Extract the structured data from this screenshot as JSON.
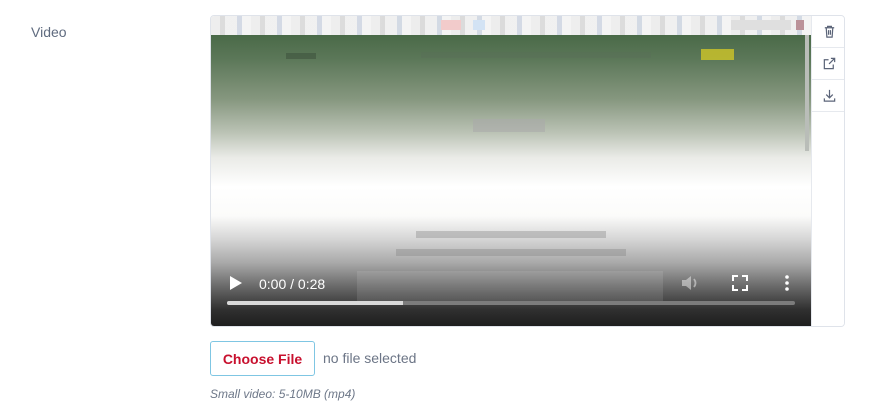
{
  "field": {
    "label": "Video"
  },
  "video": {
    "current_time": "0:00",
    "separator": " / ",
    "duration": "0:28",
    "progress_percent": 31
  },
  "actions": [
    {
      "icon": "trash-icon"
    },
    {
      "icon": "external-link-icon"
    },
    {
      "icon": "download-icon"
    }
  ],
  "upload": {
    "button_label": "Choose File",
    "status": "no file selected",
    "hint": "Small video: 5-10MB (mp4)"
  },
  "colors": {
    "accent_red": "#c8102e",
    "button_border": "#7fc6e3",
    "label_gray": "#5f6b7f"
  }
}
